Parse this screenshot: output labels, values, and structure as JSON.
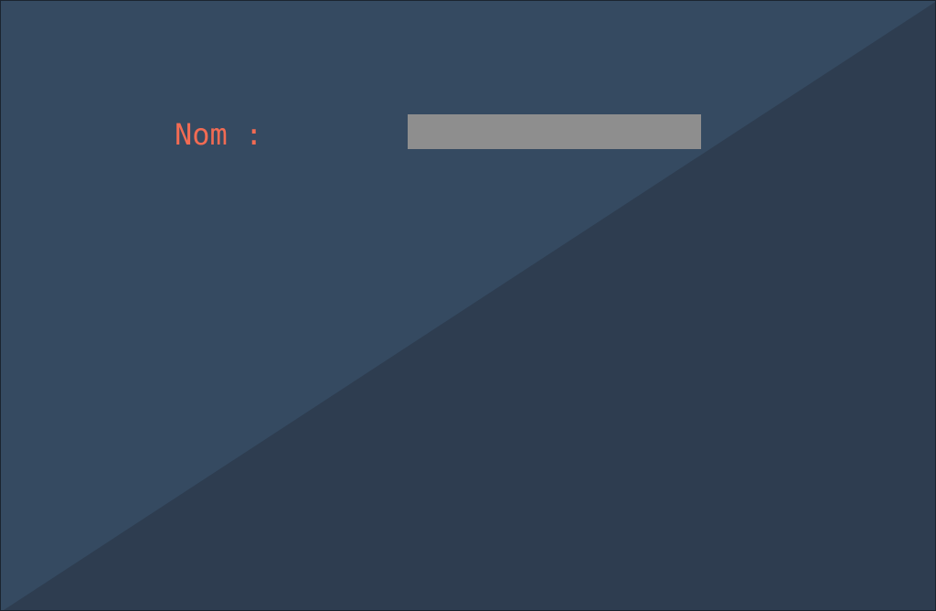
{
  "form": {
    "name_label": "Nom :",
    "name_value": "",
    "name_placeholder": ""
  },
  "colors": {
    "background_upper": "#354a61",
    "background_lower": "#2e3d50",
    "label_text": "#f26b53",
    "input_fill": "#8e8e8e"
  }
}
